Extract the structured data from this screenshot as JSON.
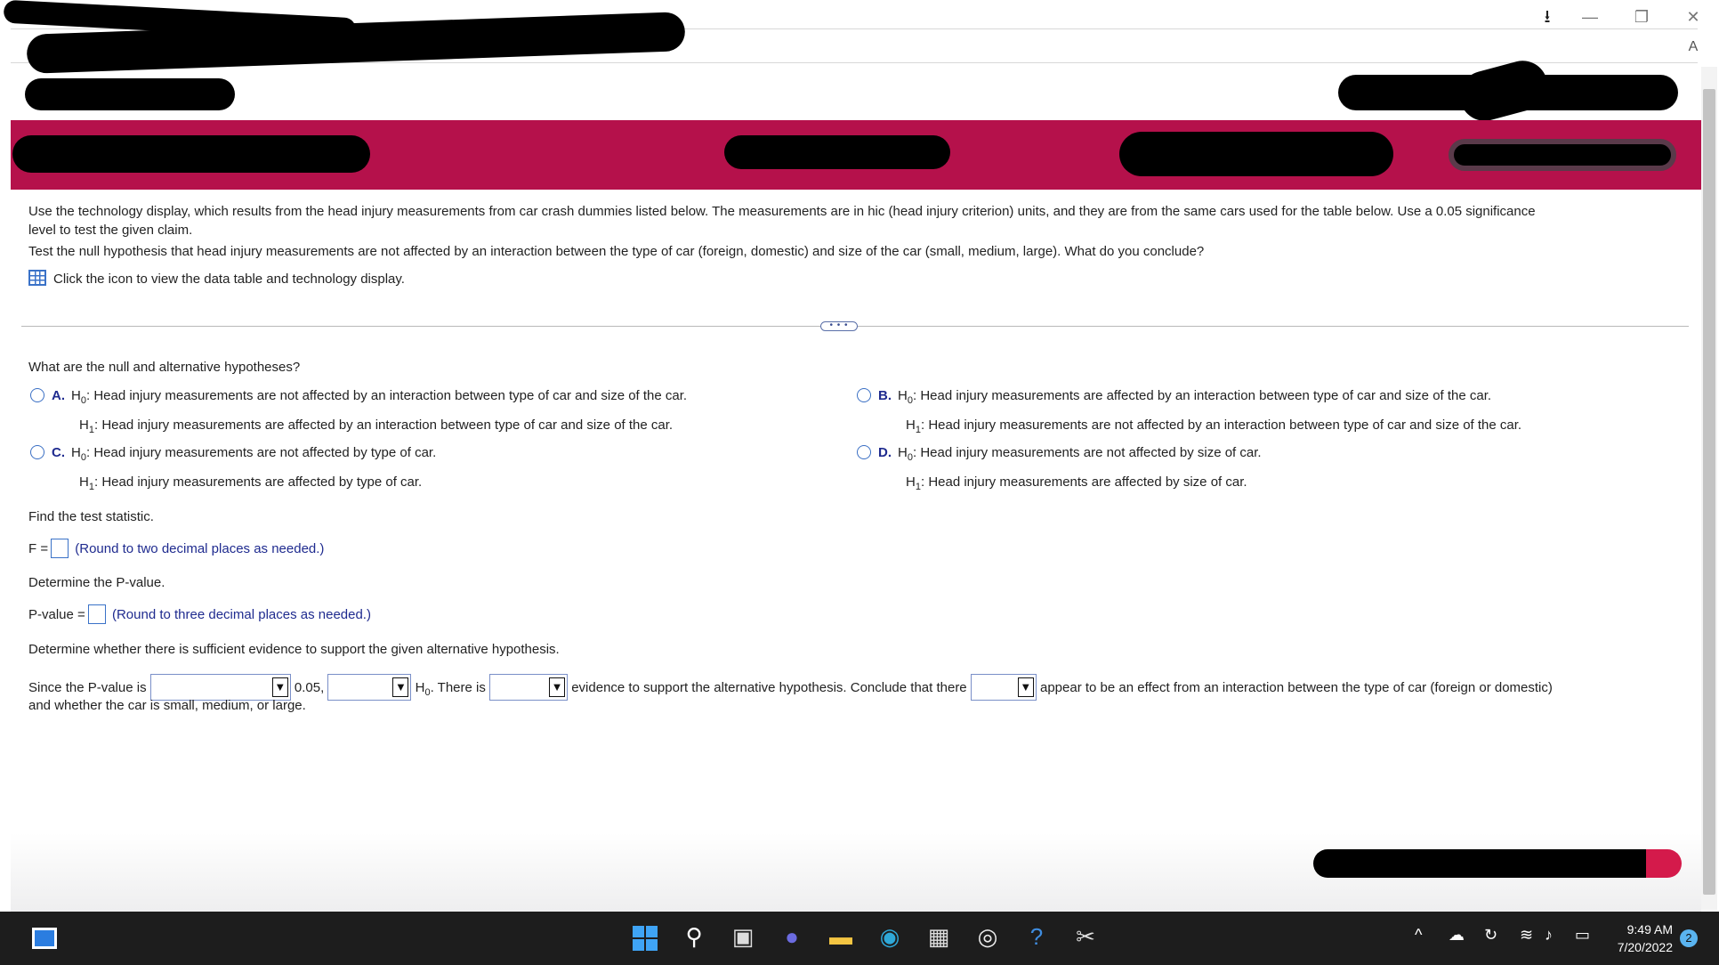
{
  "browser": {
    "read_aloud_label": "A",
    "minimize_glyph": "—",
    "restore_glyph": "❐",
    "close_glyph": "✕",
    "download_glyph": "⭳"
  },
  "question": {
    "intro_line1": "Use the technology display, which results from the head injury measurements from car crash dummies listed below. The measurements are in hic (head injury criterion) units, and they are from the same cars used for the table below. Use a 0.05 significance",
    "intro_line2": "level to test the given claim.",
    "test_line": "Test the null hypothesis that head injury measurements are not affected by an interaction between the type of car (foreign, domestic) and size of the car (small, medium, large). What do you conclude?",
    "data_link": "Click the icon to view the data table and technology display.",
    "more_button": "• • •"
  },
  "hypotheses": {
    "prompt": "What are the null and alternative hypotheses?",
    "options": [
      {
        "letter": "A.",
        "h0": "Head injury measurements are not affected by an interaction between type of car and size of the car.",
        "h1": "Head injury measurements are affected by an interaction between type of car and size of the car."
      },
      {
        "letter": "B.",
        "h0": "Head injury measurements are affected by an interaction between type of car and size of the car.",
        "h1": "Head injury measurements are not affected by an interaction between type of car and size of the car."
      },
      {
        "letter": "C.",
        "h0": "Head injury measurements are not affected by type of car.",
        "h1": "Head injury measurements are affected by type of car."
      },
      {
        "letter": "D.",
        "h0": "Head injury measurements are not affected by size of car.",
        "h1": "Head injury measurements are affected by size of car."
      }
    ],
    "h0_label": "H",
    "h0_sub": "0",
    "h1_label": "H",
    "h1_sub": "1"
  },
  "test_stat": {
    "prompt": "Find the test statistic.",
    "label": "F =",
    "hint": "(Round to two decimal places as needed.)"
  },
  "pvalue": {
    "prompt": "Determine the P-value.",
    "label": "P-value =",
    "hint": "(Round to three decimal places as needed.)"
  },
  "conclusion": {
    "prompt": "Determine whether there is sufficient evidence to support the given alternative hypothesis.",
    "part1": "Since the P-value is",
    "part2": "0.05,",
    "part3_h": "H",
    "part3_sub": "0",
    "part3_tail": ". There is",
    "part4": "evidence to support the alternative hypothesis. Conclude that there",
    "part5": "appear to be an effect from an interaction between the type of car (foreign or domestic)",
    "line2": "and whether the car is small, medium, or large.",
    "dropdown_arrow": "▼"
  },
  "taskbar": {
    "time": "9:49 AM",
    "date": "7/20/2022",
    "notification_count": "2"
  }
}
